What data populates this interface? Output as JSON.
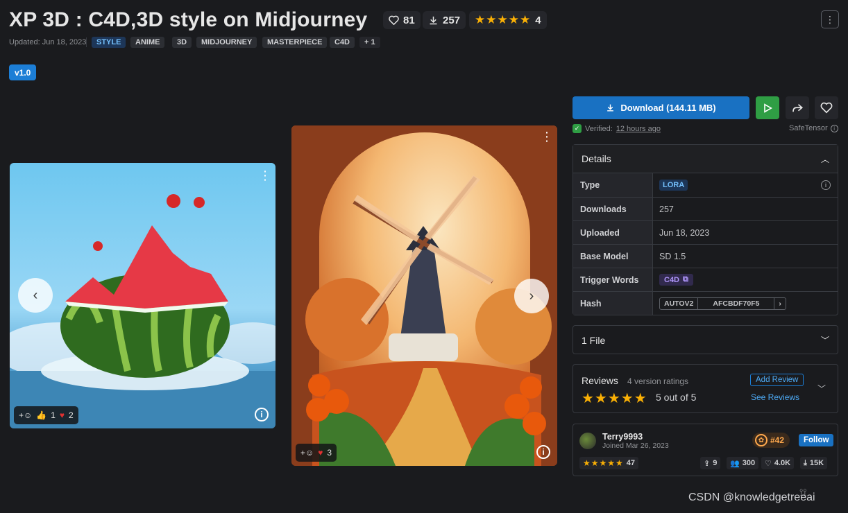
{
  "header": {
    "title": "XP 3D : C4D,3D style on Midjourney",
    "likes": "81",
    "downloads": "257",
    "rating_count": "4",
    "rating_stars": "★★★★★",
    "updated": "Updated: Jun 18, 2023",
    "tags": [
      "STYLE",
      "ANIME",
      "3D",
      "MIDJOURNEY",
      "MASTERPIECE",
      "C4D",
      "+ 1"
    ],
    "version": "v1.0"
  },
  "gallery": {
    "image1": {
      "reactions": {
        "like": "1",
        "heart": "2"
      }
    },
    "image2": {
      "reactions": {
        "heart": "3"
      }
    }
  },
  "download": {
    "label": "Download (144.11 MB)",
    "verified_label": "Verified:",
    "verified_time": "12 hours ago",
    "format": "SafeTensor"
  },
  "details": {
    "heading": "Details",
    "rows": [
      {
        "key": "Type",
        "value": "LORA"
      },
      {
        "key": "Downloads",
        "value": "257"
      },
      {
        "key": "Uploaded",
        "value": "Jun 18, 2023"
      },
      {
        "key": "Base Model",
        "value": "SD 1.5"
      },
      {
        "key": "Trigger Words",
        "value": "C4D"
      },
      {
        "key": "Hash",
        "value": "AFCBDF70F5",
        "algo": "AUTOV2"
      }
    ]
  },
  "files": {
    "label": "1 File"
  },
  "reviews": {
    "title": "Reviews",
    "subtitle": "4 version ratings",
    "stars": "★★★★★",
    "score": "5 out of 5",
    "add_label": "Add Review",
    "see_label": "See Reviews"
  },
  "creator": {
    "name": "Terry9993",
    "joined": "Joined Mar 26, 2023",
    "rank": "#42",
    "follow_label": "Follow",
    "stars": "★★★★★",
    "rating": "47",
    "uploads": "9",
    "followers": "300",
    "likes": "4.0K",
    "downloads": "15K"
  },
  "watermark": "CSDN @knowledgetreeai",
  "colors": {
    "accent": "#1971c2",
    "green": "#2f9e44",
    "star": "#fab005",
    "bg": "#1a1b1e"
  }
}
